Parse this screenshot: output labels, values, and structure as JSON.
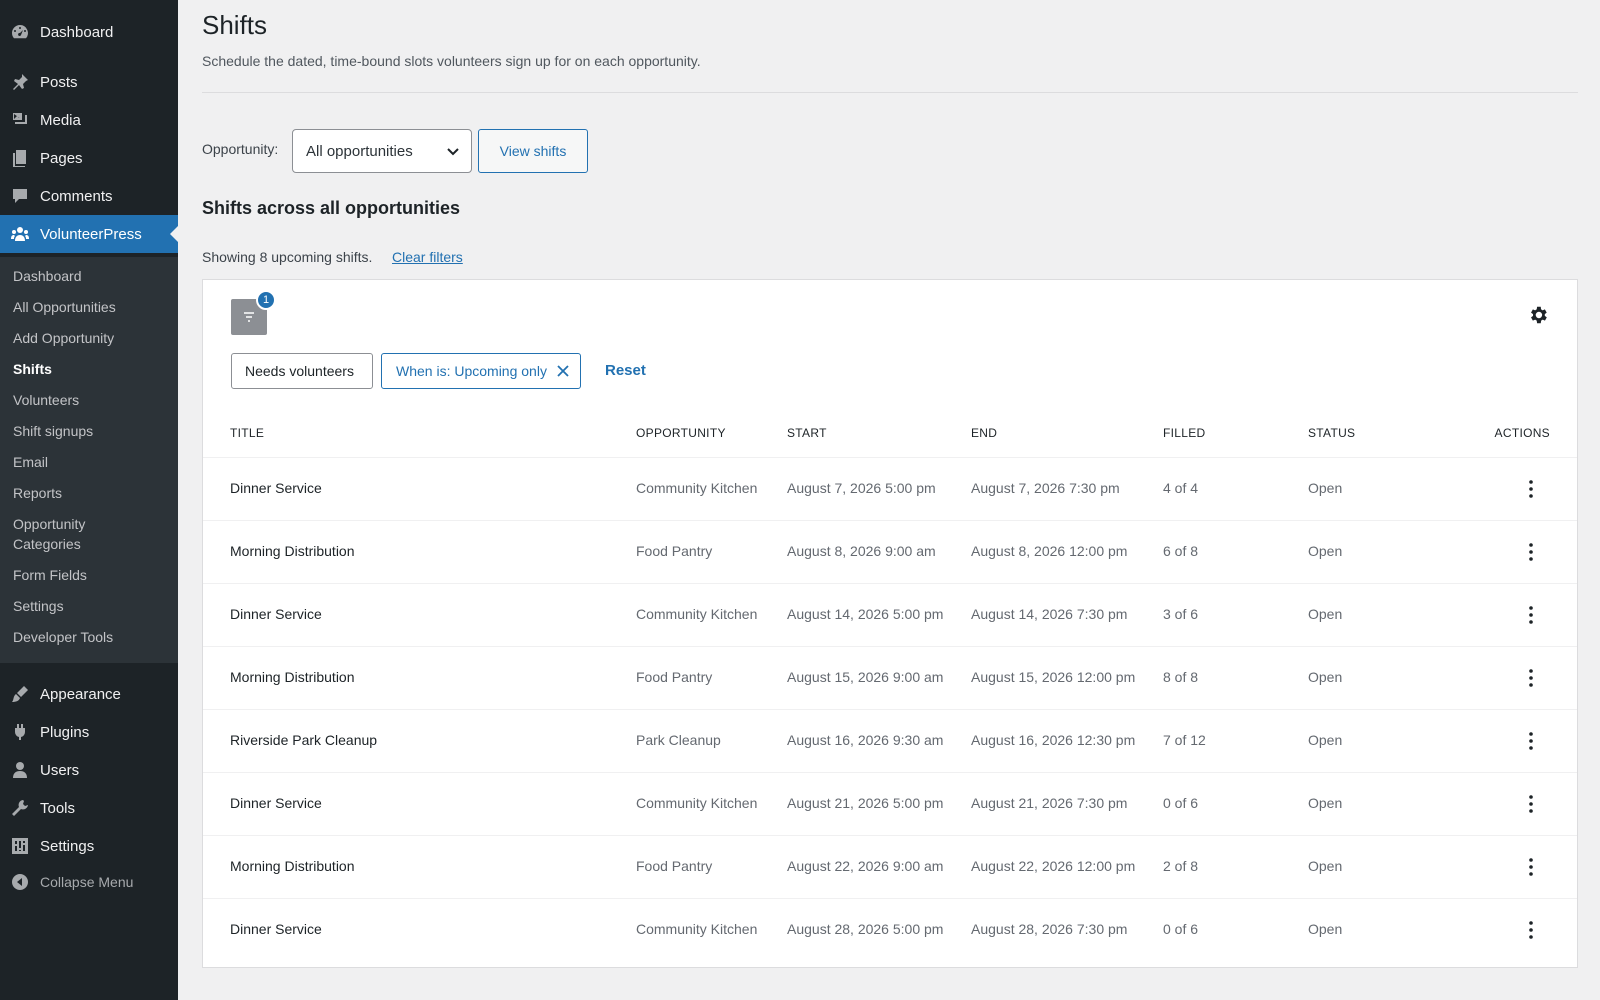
{
  "sidebar": {
    "top_items": [
      {
        "label": "Dashboard",
        "icon": "dashboard-icon"
      },
      {
        "label": "Posts",
        "icon": "pin-icon"
      },
      {
        "label": "Media",
        "icon": "media-icon"
      },
      {
        "label": "Pages",
        "icon": "pages-icon"
      },
      {
        "label": "Comments",
        "icon": "comments-icon"
      },
      {
        "label": "VolunteerPress",
        "icon": "groups-icon"
      }
    ],
    "submenu": [
      "Dashboard",
      "All Opportunities",
      "Add Opportunity",
      "Shifts",
      "Volunteers",
      "Shift signups",
      "Email",
      "Reports",
      "Opportunity Categories",
      "Form Fields",
      "Settings",
      "Developer Tools"
    ],
    "bottom_items": [
      {
        "label": "Appearance",
        "icon": "brush-icon"
      },
      {
        "label": "Plugins",
        "icon": "plug-icon"
      },
      {
        "label": "Users",
        "icon": "users-icon"
      },
      {
        "label": "Tools",
        "icon": "wrench-icon"
      },
      {
        "label": "Settings",
        "icon": "settings-icon"
      }
    ],
    "collapse_label": "Collapse Menu"
  },
  "page": {
    "title": "Shifts",
    "description": "Schedule the dated, time-bound slots volunteers sign up for on each opportunity."
  },
  "filter_form": {
    "label": "Opportunity:",
    "selected": "All opportunities",
    "button": "View shifts"
  },
  "section_title": "Shifts across all opportunities",
  "summary": {
    "showing": "Showing 8 upcoming shifts.",
    "clear": "Clear filters"
  },
  "toolbar": {
    "filter_count": "1",
    "chips": [
      "Needs volunteers",
      "When is: Upcoming only"
    ],
    "reset": "Reset"
  },
  "table": {
    "columns": [
      "TITLE",
      "OPPORTUNITY",
      "START",
      "END",
      "FILLED",
      "STATUS",
      "ACTIONS"
    ],
    "rows": [
      [
        "Dinner Service",
        "Community Kitchen",
        "August 7, 2026 5:00 pm",
        "August 7, 2026 7:30 pm",
        "4 of 4",
        "Open"
      ],
      [
        "Morning Distribution",
        "Food Pantry",
        "August 8, 2026 9:00 am",
        "August 8, 2026 12:00 pm",
        "6 of 8",
        "Open"
      ],
      [
        "Dinner Service",
        "Community Kitchen",
        "August 14, 2026 5:00 pm",
        "August 14, 2026 7:30 pm",
        "3 of 6",
        "Open"
      ],
      [
        "Morning Distribution",
        "Food Pantry",
        "August 15, 2026 9:00 am",
        "August 15, 2026 12:00 pm",
        "8 of 8",
        "Open"
      ],
      [
        "Riverside Park Cleanup",
        "Park Cleanup",
        "August 16, 2026 9:30 am",
        "August 16, 2026 12:30 pm",
        "7 of 12",
        "Open"
      ],
      [
        "Dinner Service",
        "Community Kitchen",
        "August 21, 2026 5:00 pm",
        "August 21, 2026 7:30 pm",
        "0 of 6",
        "Open"
      ],
      [
        "Morning Distribution",
        "Food Pantry",
        "August 22, 2026 9:00 am",
        "August 22, 2026 12:00 pm",
        "2 of 8",
        "Open"
      ],
      [
        "Dinner Service",
        "Community Kitchen",
        "August 28, 2026 5:00 pm",
        "August 28, 2026 7:30 pm",
        "0 of 6",
        "Open"
      ]
    ]
  },
  "colors": {
    "sidebar_bg": "#1d2327",
    "submenu_bg": "#2c3338",
    "accent": "#2271b1",
    "page_bg": "#f0f0f1"
  }
}
